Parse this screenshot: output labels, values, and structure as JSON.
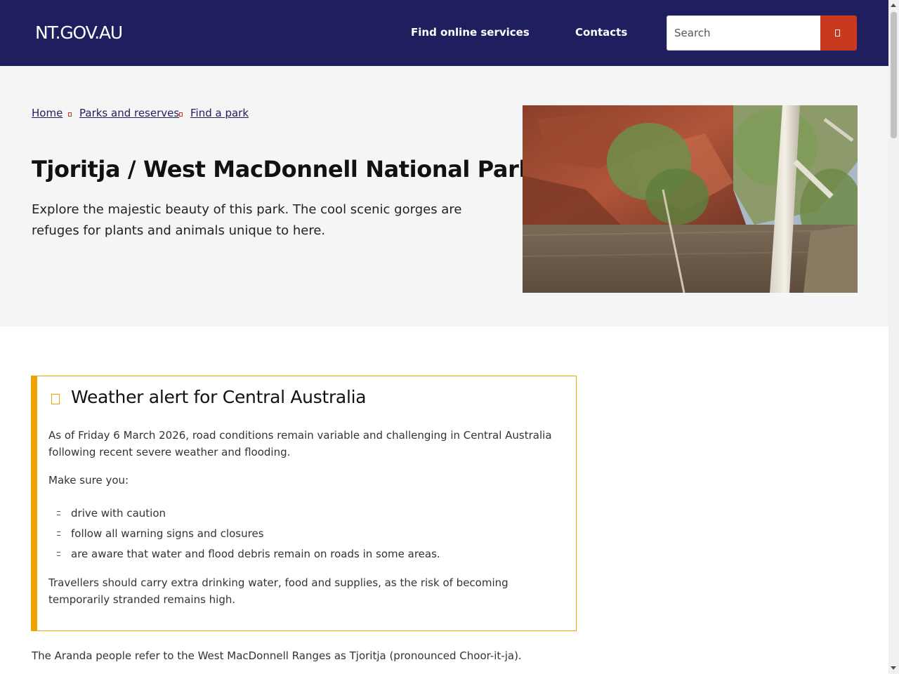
{
  "header": {
    "logo": "NT.GOV.AU",
    "nav": {
      "find_services": "Find online services",
      "contacts": "Contacts"
    },
    "search": {
      "placeholder": "Search",
      "button_icon": "search-icon"
    }
  },
  "breadcrumb": {
    "items": [
      "Home",
      "Parks and reserves",
      "Find a park"
    ],
    "separator_icon": "chevron-right-icon"
  },
  "hero": {
    "title": "Tjoritja / West MacDonnell National Park",
    "intro": "Explore the majestic beauty of this park. The cool scenic gorges are refuges for plants and animals unique to here."
  },
  "alert": {
    "icon": "warning-icon",
    "title": "Weather alert for Central Australia",
    "paragraph1": "As of Friday 6 March 2026, road conditions remain variable and challenging in Central Australia following recent severe weather and flooding.",
    "paragraph2": "Make sure you:",
    "list": [
      "drive with caution",
      "follow all warning signs and closures",
      "are aware that water and flood debris remain on roads in some areas."
    ],
    "paragraph3": "Travellers should carry extra drinking water, food and supplies, as the risk of becoming temporarily stranded remains high."
  },
  "body": {
    "paragraph1": "The Aranda people refer to the West MacDonnell Ranges as Tjoritja (pronounced Choor-it-ja)."
  },
  "colors": {
    "header_bg": "#1f1e5f",
    "search_button": "#c8391d",
    "alert_accent": "#f0a200",
    "hero_bg": "#f5f5f5"
  }
}
